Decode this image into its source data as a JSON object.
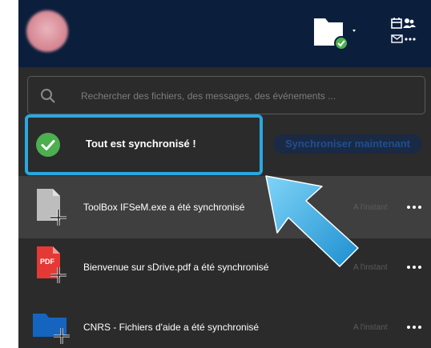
{
  "header": {
    "avatar": "avatar",
    "folder_icon": "folder-check-icon",
    "calendar_contacts_icon": "calendar-contacts-mail-icon"
  },
  "search": {
    "placeholder": "Rechercher des fichiers, des messages, des événements ..."
  },
  "status": {
    "text": "Tout est synchronisé !",
    "sync_button": "Synchroniser maintenant",
    "highlight_color": "#29a8e0",
    "check_color": "#4caf50"
  },
  "activity": [
    {
      "icon": "file-generic-add-icon",
      "text": "ToolBox IFSeM.exe a été synchronisé",
      "time": "A l'instant"
    },
    {
      "icon": "pdf-file-add-icon",
      "text": "Bienvenue sur sDrive.pdf a été synchronisé",
      "time": "A l'instant"
    },
    {
      "icon": "folder-add-icon",
      "text": "CNRS - Fichiers d'aide a été synchronisé",
      "time": "A l'instant"
    }
  ],
  "colors": {
    "header_bg": "#0b1f3d",
    "panel_bg": "#2b2b2b",
    "accent_blue": "#29a8e0"
  }
}
